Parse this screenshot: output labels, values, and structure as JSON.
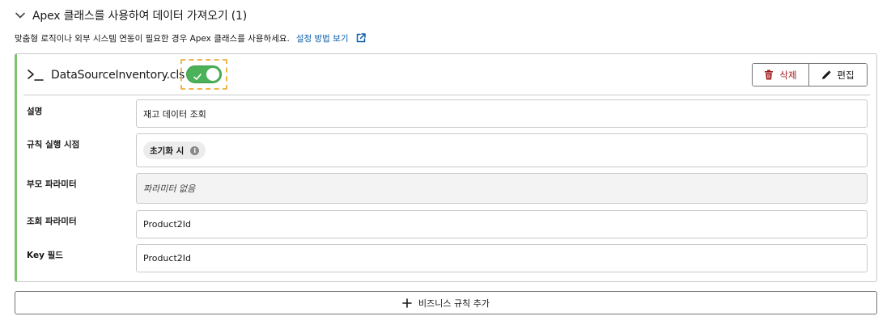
{
  "section": {
    "title": "Apex 클래스를 사용하여 데이터 가져오기 (1)",
    "description": "맞춤형 로직이나 외부 시스템 연동이 필요한 경우 Apex 클래스를 사용하세요.",
    "setup_link": "설정 방법 보기"
  },
  "card": {
    "file_name": "DataSourceInventory.cls",
    "toggle_on": true,
    "delete_label": "삭제",
    "edit_label": "편집",
    "rows": [
      {
        "label": "설명",
        "value": "재고 데이터 조회"
      },
      {
        "label": "규칙 실행 시점",
        "value": "초기화 시"
      },
      {
        "label": "부모 파라미터",
        "value": "파라미터 없음"
      },
      {
        "label": "조회 파라미터",
        "value": "Product2Id"
      },
      {
        "label": "Key 필드",
        "value": "Product2Id"
      }
    ]
  },
  "add_rule_label": "비즈니스 규칙 추가",
  "colors": {
    "accent_green": "#4bb25a",
    "card_border_left": "#7cc46f",
    "link": "#0b5cab",
    "delete": "#a01d1d",
    "focus_outline": "#f0b64a"
  }
}
